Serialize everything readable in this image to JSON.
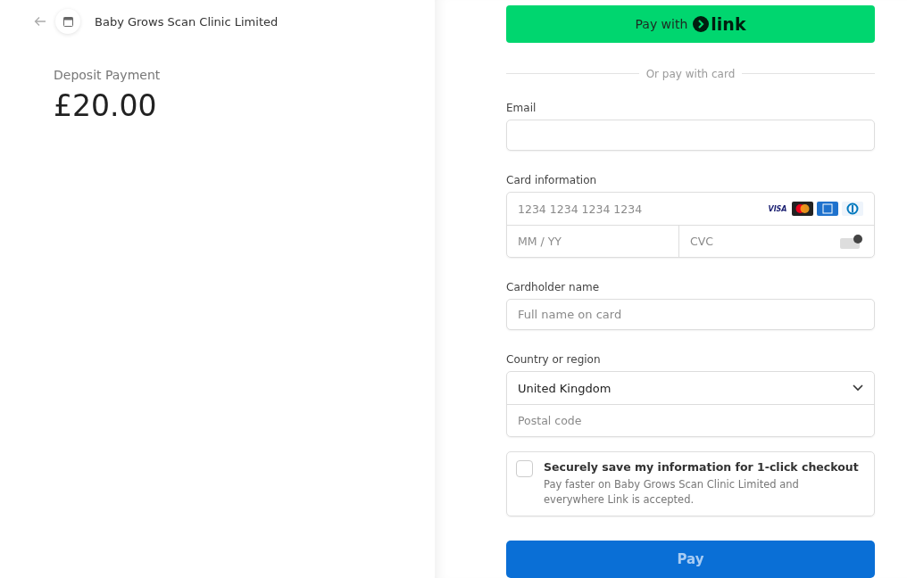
{
  "header": {
    "merchant": "Baby Grows Scan Clinic Limited"
  },
  "summary": {
    "label": "Deposit Payment",
    "amount": "£20.00"
  },
  "link_button": {
    "label": "Pay with",
    "brand": "link"
  },
  "divider": "Or pay with card",
  "email": {
    "label": "Email"
  },
  "card": {
    "label": "Card information",
    "number_placeholder": "1234 1234 1234 1234",
    "expiry_placeholder": "MM / YY",
    "cvc_placeholder": "CVC",
    "brands": [
      {
        "kind": "visa",
        "text": "VISA"
      },
      {
        "kind": "mastercard"
      },
      {
        "kind": "amex"
      },
      {
        "kind": "diners"
      }
    ]
  },
  "cardholder": {
    "label": "Cardholder name",
    "placeholder": "Full name on card"
  },
  "country": {
    "label": "Country or region",
    "value": "United Kingdom",
    "postal_placeholder": "Postal code"
  },
  "save": {
    "checked": false,
    "title": "Securely save my information for 1-click checkout",
    "text": "Pay faster on Baby Grows Scan Clinic Limited and everywhere Link is accepted."
  },
  "pay_button": "Pay"
}
